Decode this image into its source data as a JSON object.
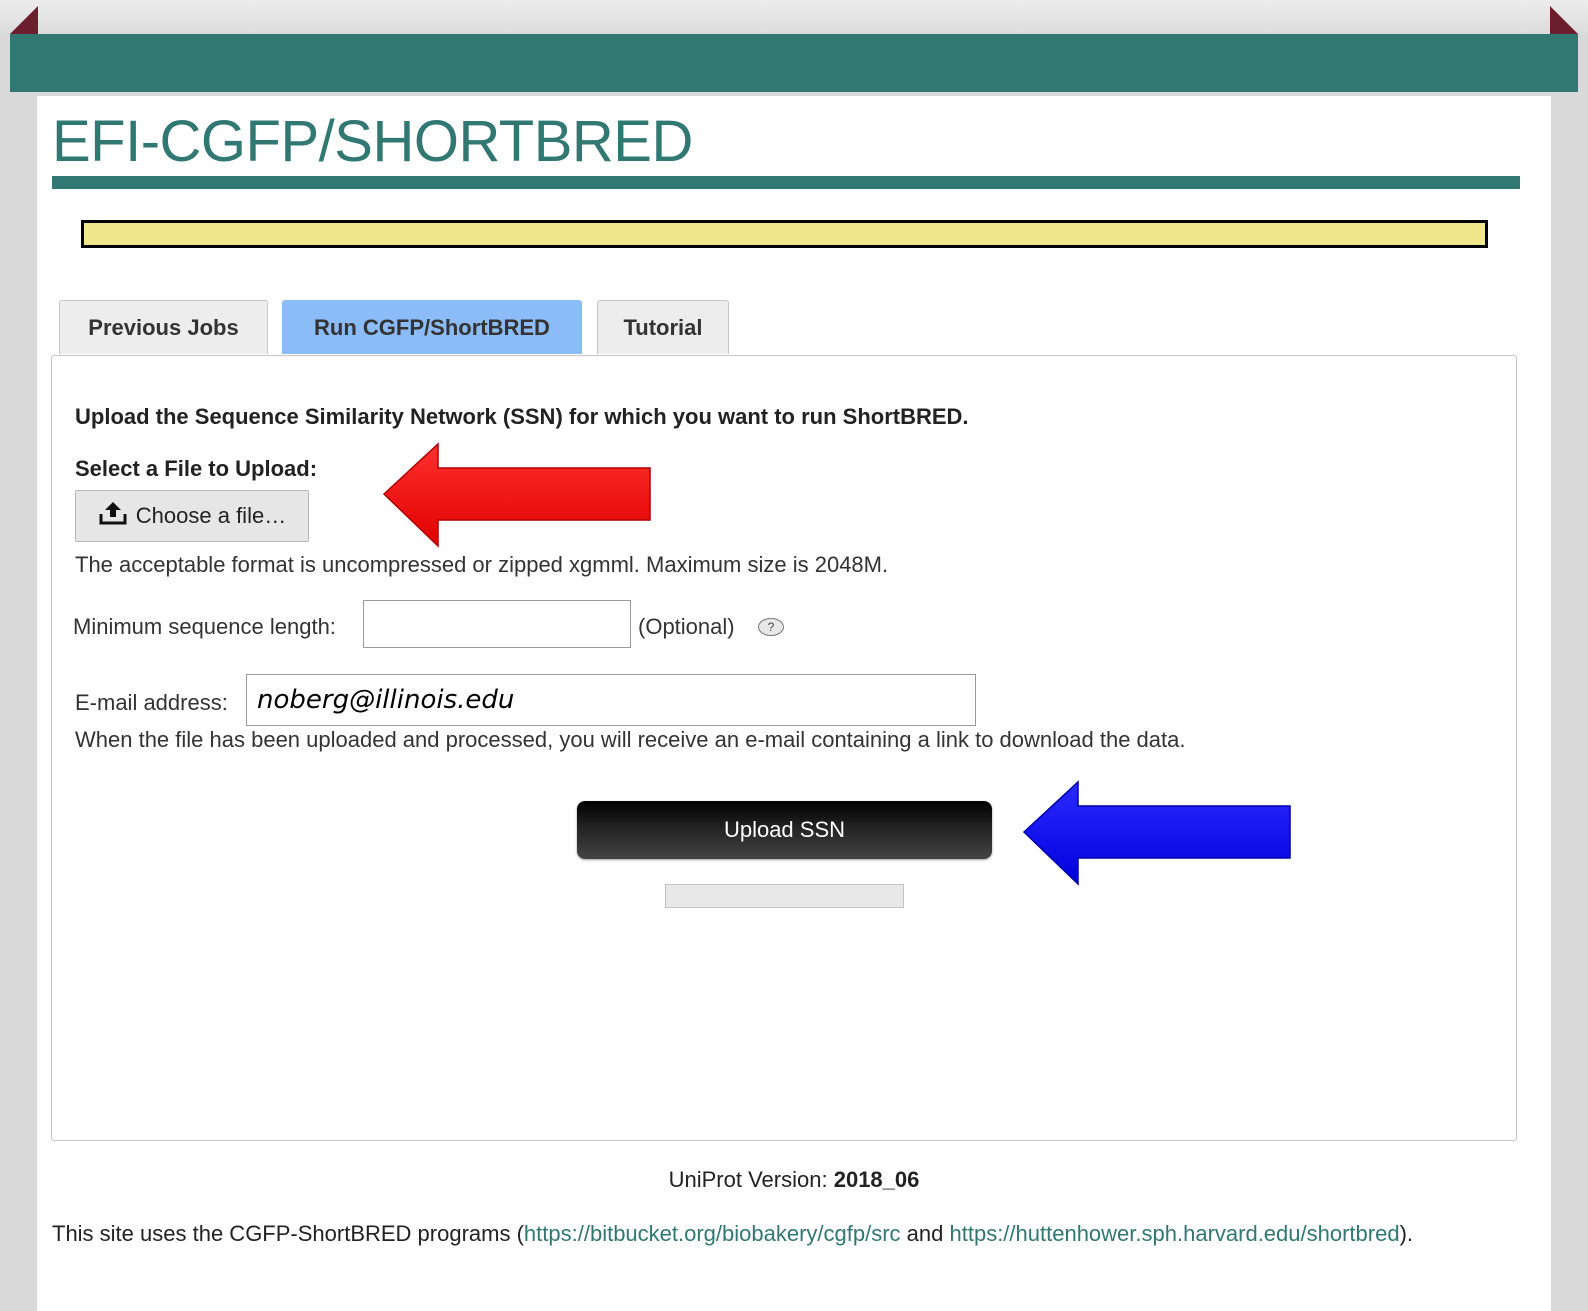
{
  "header": {
    "site_title": "EFI-CGFP/SHORTBRED"
  },
  "tabs": [
    {
      "label": "Previous Jobs",
      "active": false
    },
    {
      "label": "Run CGFP/ShortBRED",
      "active": true
    },
    {
      "label": "Tutorial",
      "active": false
    }
  ],
  "form": {
    "intro": "Upload the Sequence Similarity Network (SSN) for which you want to run ShortBRED.",
    "file_label": "Select a File to Upload:",
    "choose_file_label": "Choose a file…",
    "format_note": "The acceptable format is uncompressed or zipped xgmml. Maximum size is 2048M.",
    "min_length_label": "Minimum sequence length:",
    "min_length_value": "",
    "optional_label": "(Optional)",
    "help_label": "?",
    "email_label": "E-mail address:",
    "email_value": "noberg@illinois.edu",
    "email_note": "When the file has been uploaded and processed, you will receive an e-mail containing a link to download the data.",
    "submit_label": "Upload SSN",
    "progress": 0
  },
  "footer": {
    "uniprot_label": "UniProt Version:",
    "uniprot_version": "2018_06",
    "credit_prefix": "This site uses the CGFP-ShortBRED programs (",
    "link1": "https://bitbucket.org/biobakery/cgfp/src",
    "credit_and": " and ",
    "link2": "https://huttenhower.sph.harvard.edu/shortbred",
    "credit_suffix": ")."
  },
  "colors": {
    "brand_teal": "#317873",
    "active_tab": "#8cbcf7",
    "banner": "#f0e68c",
    "annotation_arrow_red": "#ff0000",
    "annotation_arrow_blue": "#0000ff"
  },
  "icons": {
    "upload": "upload-icon",
    "help": "help-icon"
  }
}
